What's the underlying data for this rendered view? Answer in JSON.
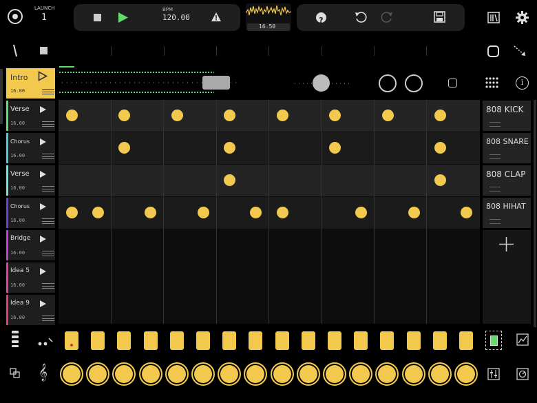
{
  "header": {
    "launch_label": "LAUNCH",
    "launch_value": "1",
    "bpm_label": "BPM",
    "bpm_value": "120.00",
    "meter_value": "16.50",
    "help_symbol": "?"
  },
  "sections": [
    {
      "name": "Intro",
      "length": "16.00",
      "color": "#f2c94c",
      "active": true
    },
    {
      "name": "Verse",
      "length": "16.00",
      "color": "#5fdc6a"
    },
    {
      "name": "Chorus",
      "length": "16.00",
      "color": "#4fc9d9"
    },
    {
      "name": "Verse",
      "length": "16.00",
      "color": "#72e0e0"
    },
    {
      "name": "Chorus",
      "length": "16.00",
      "color": "#6a3fd6"
    },
    {
      "name": "Bridge",
      "length": "16.00",
      "color": "#c23fd6"
    },
    {
      "name": "Idea 5",
      "length": "16.00",
      "color": "#e03fa0"
    },
    {
      "name": "Idea 9",
      "length": "16.00",
      "color": "#e03f6a"
    }
  ],
  "instruments": [
    {
      "label": "808 KICK"
    },
    {
      "label": "808 SNARE"
    },
    {
      "label": "808 CLAP"
    },
    {
      "label": "808 HIHAT"
    }
  ],
  "pattern": {
    "steps_per_track": 16,
    "kick": [
      0,
      2,
      4,
      6,
      8,
      10,
      12,
      14
    ],
    "snare": [
      2,
      6,
      10,
      14
    ],
    "clap": [
      6,
      14
    ],
    "hihat": [
      0,
      1,
      3,
      5,
      7,
      8,
      11,
      13,
      15
    ]
  },
  "step_buttons": {
    "count": 16,
    "active_marker_step": 0
  },
  "colors": {
    "accent": "#f2c94c",
    "play": "#5fdc6a",
    "meter": "#f2c94c"
  },
  "icons": {
    "record": "record-icon",
    "stop": "stop-icon",
    "play": "play-icon",
    "warning": "warning-icon",
    "help": "help-icon",
    "undo": "undo-icon",
    "redo": "redo-icon",
    "save": "save-icon",
    "library": "library-icon",
    "settings": "gear-icon",
    "pencil": "pencil-icon",
    "add": "plus-icon"
  }
}
